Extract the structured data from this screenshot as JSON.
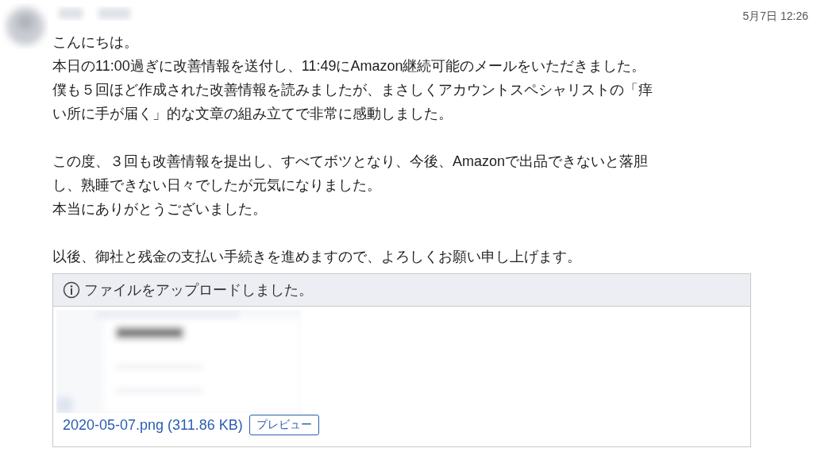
{
  "timestamp": "5月7日 12:26",
  "paragraphs": [
    [
      "こんにちは。",
      "本日の11:00過ぎに改善情報を送付し、11:49にAmazon継続可能のメールをいただきました。",
      "僕も５回ほど作成された改善情報を読みましたが、まさしくアカウントスペシャリストの「痒",
      "い所に手が届く」的な文章の組み立てで非常に感動しました。"
    ],
    [
      "この度、３回も改善情報を提出し、すべてボツとなり、今後、Amazonで出品できないと落胆",
      "し、熟睡できない日々でしたが元気になりました。",
      "本当にありがとうございました。"
    ],
    [
      "以後、御社と残金の支払い手続きを進めますので、よろしくお願い申し上げます。"
    ]
  ],
  "attachment": {
    "notice": "ファイルをアップロードしました。",
    "file_link": "2020-05-07.png (311.86 KB)",
    "preview_button": "プレビュー"
  }
}
